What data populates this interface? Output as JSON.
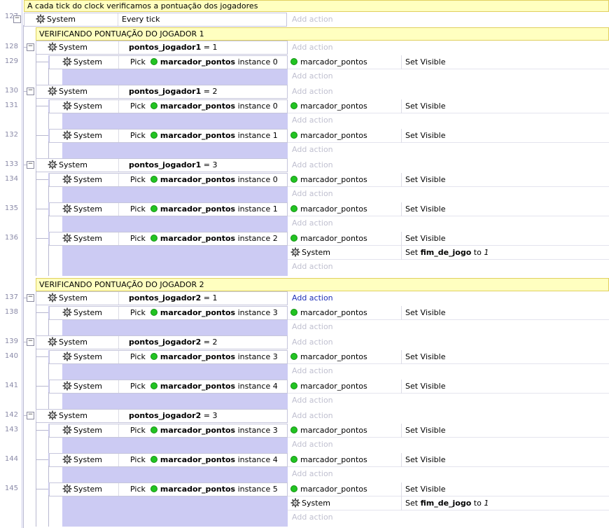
{
  "colors": {
    "comment_bg": "#ffffc0",
    "sub_event_bg": "#cccbf3",
    "green_dot": "#22c322",
    "add_action_active": "#2030b8"
  },
  "header_comment": {
    "line": "127",
    "text": "A cada tick do clock verificamos a pontuação dos jogadores"
  },
  "top_event": {
    "object": "System",
    "condition": "Every tick",
    "add_action": "Add action"
  },
  "common": {
    "system": "System",
    "pick": "Pick",
    "object": "marcador_pontos",
    "instance_word": "instance",
    "set_visible": "Set Visible",
    "set_word": "Set",
    "var_fim": "fim_de_jogo",
    "to_word": "to",
    "value_1": "1",
    "add_action": "Add action",
    "equals": "="
  },
  "groups": [
    {
      "comment": "VERIFICANDO PONTUAÇÃO DO JOGADOR 1",
      "events": [
        {
          "line": "128",
          "var": "pontos_jogador1",
          "val": "1",
          "subs": [
            {
              "line": "129",
              "inst": "0",
              "fim": false
            }
          ]
        },
        {
          "line": "130",
          "var": "pontos_jogador1",
          "val": "2",
          "subs": [
            {
              "line": "131",
              "inst": "0",
              "fim": false
            },
            {
              "line": "132",
              "inst": "1",
              "fim": false
            }
          ]
        },
        {
          "line": "133",
          "var": "pontos_jogador1",
          "val": "3",
          "subs": [
            {
              "line": "134",
              "inst": "0",
              "fim": false
            },
            {
              "line": "135",
              "inst": "1",
              "fim": false
            },
            {
              "line": "136",
              "inst": "2",
              "fim": true
            }
          ]
        }
      ]
    },
    {
      "comment": "VERIFICANDO PONTUAÇÃO DO JOGADOR 2",
      "events": [
        {
          "line": "137",
          "var": "pontos_jogador2",
          "val": "1",
          "active": true,
          "subs": [
            {
              "line": "138",
              "inst": "3",
              "fim": false
            }
          ]
        },
        {
          "line": "139",
          "var": "pontos_jogador2",
          "val": "2",
          "subs": [
            {
              "line": "140",
              "inst": "3",
              "fim": false
            },
            {
              "line": "141",
              "inst": "4",
              "fim": false
            }
          ]
        },
        {
          "line": "142",
          "var": "pontos_jogador2",
          "val": "3",
          "subs": [
            {
              "line": "143",
              "inst": "3",
              "fim": false
            },
            {
              "line": "144",
              "inst": "4",
              "fim": false
            },
            {
              "line": "145",
              "inst": "5",
              "fim": true
            }
          ]
        }
      ]
    }
  ]
}
